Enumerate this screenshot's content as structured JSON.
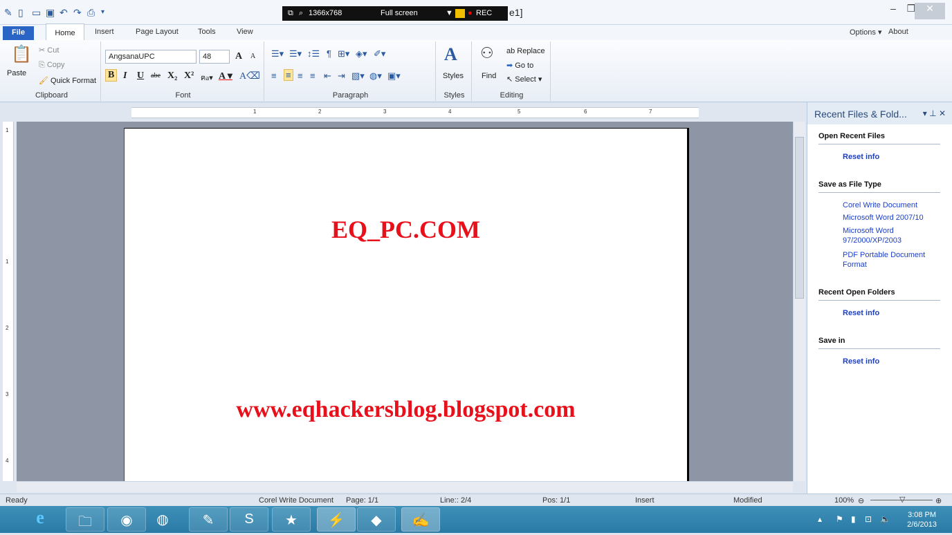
{
  "recorder": {
    "resolution": "1366x768",
    "mode": "Full screen",
    "rec_label": "REC"
  },
  "window": {
    "title_fragment": "e1]"
  },
  "menu": {
    "file": "File",
    "tabs": [
      "Home",
      "Insert",
      "Page Layout",
      "Tools",
      "View"
    ],
    "options": "Options",
    "about": "About"
  },
  "clipboard": {
    "paste": "Paste",
    "cut": "Cut",
    "copy": "Copy",
    "quick_format": "Quick Format",
    "label": "Clipboard"
  },
  "font": {
    "name": "AngsanaUPC",
    "size": "48",
    "label": "Font"
  },
  "paragraph": {
    "label": "Paragraph"
  },
  "styles": {
    "button": "Styles",
    "label": "Styles"
  },
  "editing": {
    "find": "Find",
    "replace": "Replace",
    "goto": "Go to",
    "select": "Select",
    "label": "Editing"
  },
  "ruler": {
    "h": [
      "1",
      "2",
      "3",
      "4",
      "5",
      "6",
      "7"
    ],
    "v": [
      "1",
      "1",
      "2",
      "3",
      "4"
    ]
  },
  "document": {
    "line1": "EQ_PC.COM",
    "line2": "www.eqhackersblog.blogspot.com",
    "text_color": "#e8101a"
  },
  "panel": {
    "title": "Recent Files & Fold...",
    "open_recent": "Open Recent Files",
    "reset1": "Reset info",
    "save_type": "Save as File Type",
    "types": [
      "Corel Write Document",
      "Microsoft Word 2007/10",
      "Microsoft Word 97/2000/XP/2003",
      "PDF Portable Document Format"
    ],
    "recent_folders": "Recent Open Folders",
    "reset2": "Reset info",
    "save_in": "Save in",
    "reset3": "Reset info"
  },
  "status": {
    "ready": "Ready",
    "doctype": "Corel Write Document",
    "page": "Page: 1/1",
    "line": "Line:: 2/4",
    "pos": "Pos: 1/1",
    "insert": "Insert",
    "modified": "Modified",
    "zoom": "100%"
  },
  "taskbar": {
    "time": "3:08 PM",
    "date": "2/6/2013",
    "icons": [
      "ie-icon",
      "explorer-icon",
      "firefox-icon",
      "chrome-icon",
      "paint-icon",
      "skype-icon",
      "star-icon",
      "app-icon",
      "glass-icon",
      "write-icon"
    ]
  }
}
